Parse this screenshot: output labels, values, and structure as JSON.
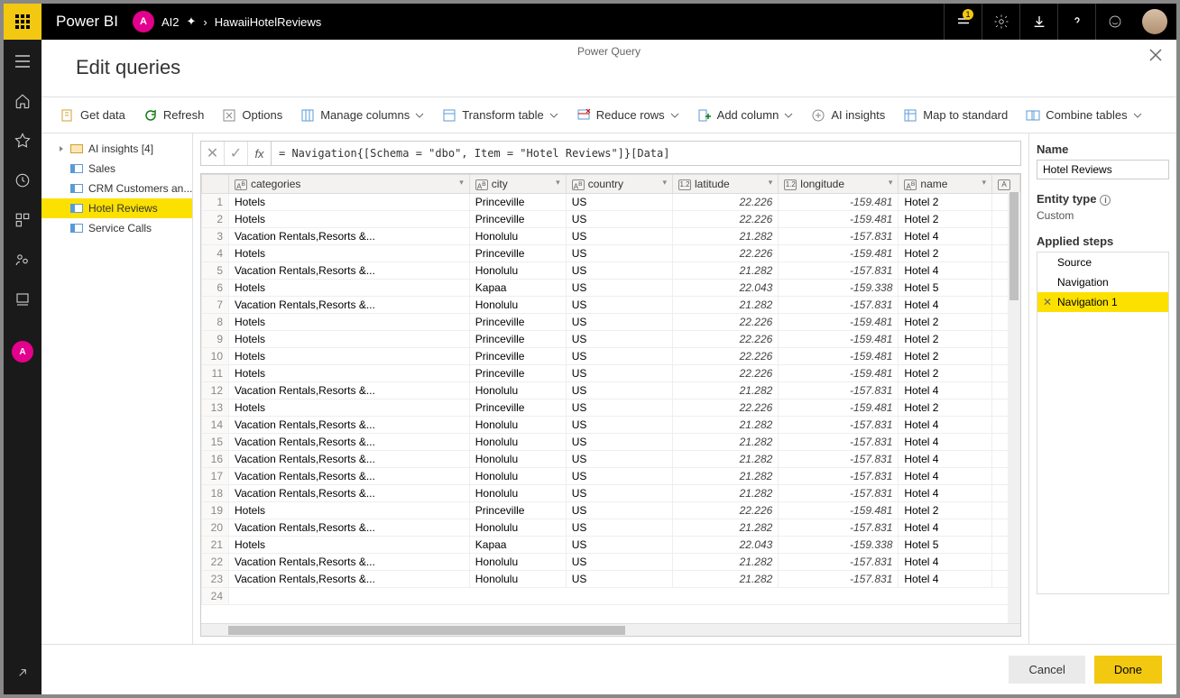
{
  "topbar": {
    "product": "Power BI",
    "workspace_letter": "A",
    "workspace": "AI2",
    "breadcrumb_item": "HawaiiHotelReviews",
    "notification_count": "1"
  },
  "pq": {
    "label": "Power Query",
    "title": "Edit queries"
  },
  "toolbar": {
    "get_data": "Get data",
    "refresh": "Refresh",
    "options": "Options",
    "manage_columns": "Manage columns",
    "transform_table": "Transform table",
    "reduce_rows": "Reduce rows",
    "add_column": "Add column",
    "ai_insights": "AI insights",
    "map_standard": "Map to standard",
    "combine_tables": "Combine tables"
  },
  "nav": {
    "group": "AI insights  [4]",
    "items": [
      "Sales",
      "CRM Customers an...",
      "Hotel Reviews",
      "Service Calls"
    ],
    "selected_index": 2
  },
  "formula": "= Navigation{[Schema = \"dbo\", Item = \"Hotel Reviews\"]}[Data]",
  "columns": [
    {
      "name": "categories",
      "type": "ABC"
    },
    {
      "name": "city",
      "type": "ABC"
    },
    {
      "name": "country",
      "type": "ABC"
    },
    {
      "name": "latitude",
      "type": "1.2"
    },
    {
      "name": "longitude",
      "type": "1.2"
    },
    {
      "name": "name",
      "type": "ABC"
    }
  ],
  "rows": [
    [
      "Hotels",
      "Princeville",
      "US",
      "22.226",
      "-159.481",
      "Hotel 2"
    ],
    [
      "Hotels",
      "Princeville",
      "US",
      "22.226",
      "-159.481",
      "Hotel 2"
    ],
    [
      "Vacation Rentals,Resorts &...",
      "Honolulu",
      "US",
      "21.282",
      "-157.831",
      "Hotel 4"
    ],
    [
      "Hotels",
      "Princeville",
      "US",
      "22.226",
      "-159.481",
      "Hotel 2"
    ],
    [
      "Vacation Rentals,Resorts &...",
      "Honolulu",
      "US",
      "21.282",
      "-157.831",
      "Hotel 4"
    ],
    [
      "Hotels",
      "Kapaa",
      "US",
      "22.043",
      "-159.338",
      "Hotel 5"
    ],
    [
      "Vacation Rentals,Resorts &...",
      "Honolulu",
      "US",
      "21.282",
      "-157.831",
      "Hotel 4"
    ],
    [
      "Hotels",
      "Princeville",
      "US",
      "22.226",
      "-159.481",
      "Hotel 2"
    ],
    [
      "Hotels",
      "Princeville",
      "US",
      "22.226",
      "-159.481",
      "Hotel 2"
    ],
    [
      "Hotels",
      "Princeville",
      "US",
      "22.226",
      "-159.481",
      "Hotel 2"
    ],
    [
      "Hotels",
      "Princeville",
      "US",
      "22.226",
      "-159.481",
      "Hotel 2"
    ],
    [
      "Vacation Rentals,Resorts &...",
      "Honolulu",
      "US",
      "21.282",
      "-157.831",
      "Hotel 4"
    ],
    [
      "Hotels",
      "Princeville",
      "US",
      "22.226",
      "-159.481",
      "Hotel 2"
    ],
    [
      "Vacation Rentals,Resorts &...",
      "Honolulu",
      "US",
      "21.282",
      "-157.831",
      "Hotel 4"
    ],
    [
      "Vacation Rentals,Resorts &...",
      "Honolulu",
      "US",
      "21.282",
      "-157.831",
      "Hotel 4"
    ],
    [
      "Vacation Rentals,Resorts &...",
      "Honolulu",
      "US",
      "21.282",
      "-157.831",
      "Hotel 4"
    ],
    [
      "Vacation Rentals,Resorts &...",
      "Honolulu",
      "US",
      "21.282",
      "-157.831",
      "Hotel 4"
    ],
    [
      "Vacation Rentals,Resorts &...",
      "Honolulu",
      "US",
      "21.282",
      "-157.831",
      "Hotel 4"
    ],
    [
      "Hotels",
      "Princeville",
      "US",
      "22.226",
      "-159.481",
      "Hotel 2"
    ],
    [
      "Vacation Rentals,Resorts &...",
      "Honolulu",
      "US",
      "21.282",
      "-157.831",
      "Hotel 4"
    ],
    [
      "Hotels",
      "Kapaa",
      "US",
      "22.043",
      "-159.338",
      "Hotel 5"
    ],
    [
      "Vacation Rentals,Resorts &...",
      "Honolulu",
      "US",
      "21.282",
      "-157.831",
      "Hotel 4"
    ],
    [
      "Vacation Rentals,Resorts &...",
      "Honolulu",
      "US",
      "21.282",
      "-157.831",
      "Hotel 4"
    ]
  ],
  "right": {
    "name_label": "Name",
    "name_value": "Hotel Reviews",
    "entity_label": "Entity type",
    "entity_value": "Custom",
    "steps_label": "Applied steps",
    "steps": [
      "Source",
      "Navigation",
      "Navigation 1"
    ],
    "selected_step": 2
  },
  "footer": {
    "cancel": "Cancel",
    "done": "Done"
  }
}
